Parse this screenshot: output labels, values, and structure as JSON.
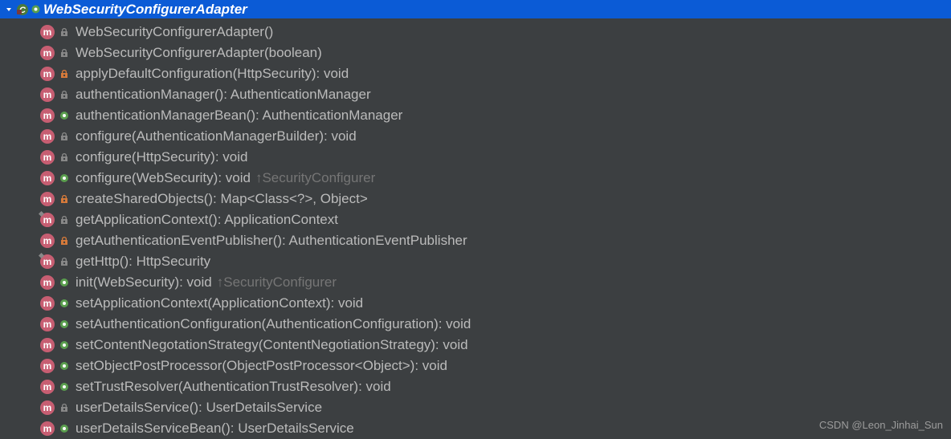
{
  "header": {
    "title": "WebSecurityConfigurerAdapter"
  },
  "methods": [
    {
      "name": "WebSecurityConfigurerAdapter()",
      "access": "protected",
      "overlay": false,
      "override": ""
    },
    {
      "name": "WebSecurityConfigurerAdapter(boolean)",
      "access": "protected",
      "overlay": false,
      "override": ""
    },
    {
      "name": "applyDefaultConfiguration(HttpSecurity): void",
      "access": "private",
      "overlay": false,
      "override": ""
    },
    {
      "name": "authenticationManager(): AuthenticationManager",
      "access": "protected",
      "overlay": false,
      "override": ""
    },
    {
      "name": "authenticationManagerBean(): AuthenticationManager",
      "access": "public",
      "overlay": false,
      "override": ""
    },
    {
      "name": "configure(AuthenticationManagerBuilder): void",
      "access": "protected",
      "overlay": false,
      "override": ""
    },
    {
      "name": "configure(HttpSecurity): void",
      "access": "protected",
      "overlay": false,
      "override": ""
    },
    {
      "name": "configure(WebSecurity): void",
      "access": "public",
      "overlay": false,
      "override": "↑SecurityConfigurer"
    },
    {
      "name": "createSharedObjects(): Map<Class<?>, Object>",
      "access": "private",
      "overlay": false,
      "override": ""
    },
    {
      "name": "getApplicationContext(): ApplicationContext",
      "access": "protected",
      "overlay": true,
      "override": ""
    },
    {
      "name": "getAuthenticationEventPublisher(): AuthenticationEventPublisher",
      "access": "private",
      "overlay": false,
      "override": ""
    },
    {
      "name": "getHttp(): HttpSecurity",
      "access": "protected",
      "overlay": true,
      "override": ""
    },
    {
      "name": "init(WebSecurity): void",
      "access": "public",
      "overlay": false,
      "override": "↑SecurityConfigurer"
    },
    {
      "name": "setApplicationContext(ApplicationContext): void",
      "access": "public",
      "overlay": false,
      "override": ""
    },
    {
      "name": "setAuthenticationConfiguration(AuthenticationConfiguration): void",
      "access": "public",
      "overlay": false,
      "override": ""
    },
    {
      "name": "setContentNegotationStrategy(ContentNegotiationStrategy): void",
      "access": "public",
      "overlay": false,
      "override": ""
    },
    {
      "name": "setObjectPostProcessor(ObjectPostProcessor<Object>): void",
      "access": "public",
      "overlay": false,
      "override": ""
    },
    {
      "name": "setTrustResolver(AuthenticationTrustResolver): void",
      "access": "public",
      "overlay": false,
      "override": ""
    },
    {
      "name": "userDetailsService(): UserDetailsService",
      "access": "protected",
      "overlay": false,
      "override": ""
    },
    {
      "name": "userDetailsServiceBean(): UserDetailsService",
      "access": "public",
      "overlay": false,
      "override": ""
    }
  ],
  "watermark": "CSDN @Leon_Jinhai_Sun"
}
